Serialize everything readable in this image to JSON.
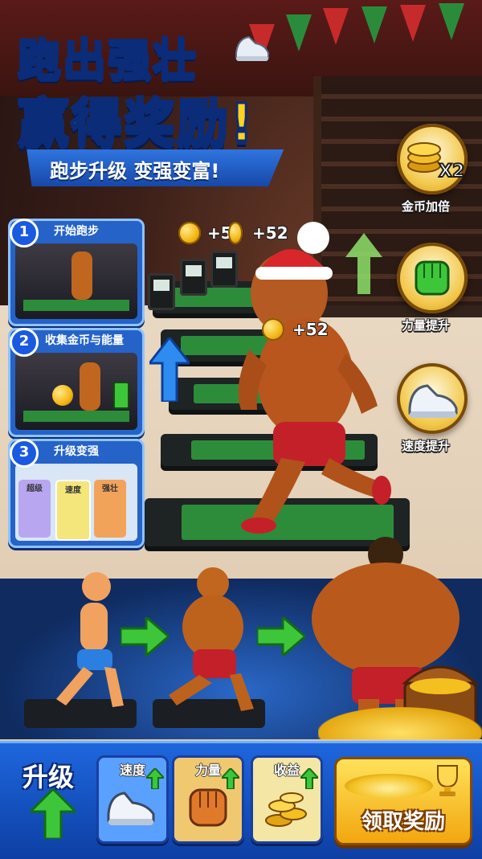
{
  "title": {
    "line1": "跑出强壮",
    "line2": "赢得奖励!",
    "banner": "跑步升级 变强变富!"
  },
  "boosters": [
    {
      "label": "金币加倍",
      "icon": "coin-stack-x2-icon",
      "badge": "X2"
    },
    {
      "label": "力量提升",
      "icon": "fist-icon"
    },
    {
      "label": "速度提升",
      "icon": "sneaker-icon"
    }
  ],
  "steps": [
    {
      "num": "1",
      "label": "开始跑步"
    },
    {
      "num": "2",
      "label": "收集金币与能量"
    },
    {
      "num": "3",
      "label": "升级变强",
      "cards": [
        "超级",
        "速度",
        "强壮"
      ]
    }
  ],
  "coin_rewards": [
    "+52",
    "+52",
    "+52"
  ],
  "bottom_bar": {
    "upgrade_label": "升级",
    "cards": [
      {
        "label": "速度",
        "icon": "sneaker-icon",
        "color": "#5aa0ff"
      },
      {
        "label": "力量",
        "icon": "fist-icon",
        "color": "#f0c870"
      },
      {
        "label": "收益",
        "icon": "coin-pile-icon",
        "color": "#f4e6a4"
      }
    ],
    "claim_label": "领取奖励"
  },
  "colors": {
    "title_yellow": "#ffd21c",
    "accent_blue": "#1e66dd",
    "green_arrow": "#3ec63a",
    "gold": "#f4b614"
  }
}
